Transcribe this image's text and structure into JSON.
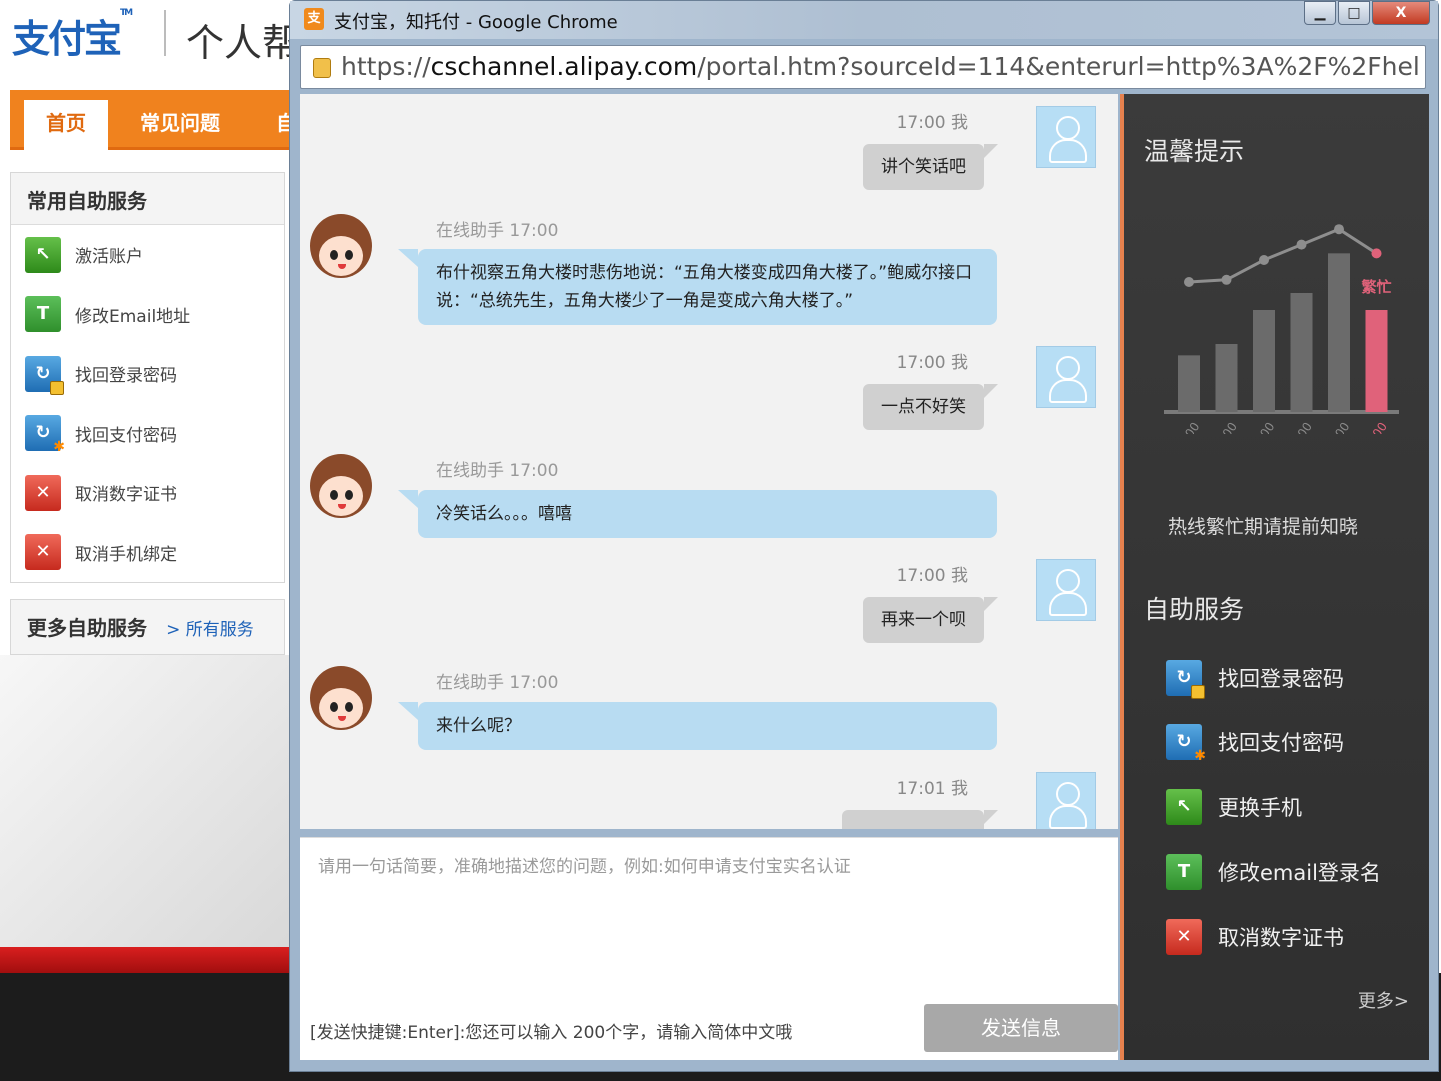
{
  "background_page": {
    "logo": "支付宝",
    "logo_tm": "TM",
    "portal_title": "个人帮",
    "tabs": [
      "首页",
      "常见问题",
      "自"
    ],
    "common_services": {
      "title": "常用自助服务",
      "items": [
        {
          "label": "激活账户",
          "icon": "activate-account-icon"
        },
        {
          "label": "修改Email地址",
          "icon": "edit-email-icon"
        },
        {
          "label": "找回登录密码",
          "icon": "recover-login-password-icon"
        },
        {
          "label": "找回支付密码",
          "icon": "recover-payment-password-icon"
        },
        {
          "label": "取消数字证书",
          "icon": "cancel-certificate-icon"
        },
        {
          "label": "取消手机绑定",
          "icon": "cancel-phone-binding-icon"
        }
      ]
    },
    "more_services": {
      "title": "更多自助服务",
      "link": "> 所有服务"
    }
  },
  "window": {
    "title": "支付宝，知托付 - Google Chrome",
    "title_icon_glyph": "支",
    "controls": {
      "minimize": "▁",
      "maximize": "□",
      "close": "X"
    },
    "url_prefix": "https://",
    "url_host": "cschannel.alipay.com",
    "url_path": "/portal.htm?sourceId=114&enterurl=http%3A%2F%2Fhelp.alipay.c"
  },
  "chat": {
    "messages": [
      {
        "from": "me",
        "meta": "17:00 我",
        "text": "讲个笑话吧"
      },
      {
        "from": "bot",
        "meta": "在线助手 17:00",
        "text": "布什视察五角大楼时悲伤地说：“五角大楼变成四角大楼了。”鲍威尔接口说：“总统先生，五角大楼少了一角是变成六角大楼了。”"
      },
      {
        "from": "me",
        "meta": "17:00 我",
        "text": "一点不好笑"
      },
      {
        "from": "bot",
        "meta": "在线助手 17:00",
        "text": "冷笑话么。。。嘻嘻"
      },
      {
        "from": "me",
        "meta": "17:00 我",
        "text": "再来一个呗"
      },
      {
        "from": "bot",
        "meta": "在线助手 17:00",
        "text": "来什么呢？"
      },
      {
        "from": "me",
        "meta": "17:01 我",
        "text": ""
      }
    ],
    "input_placeholder": "请用一句话简要，准确地描述您的问题，例如:如何申请支付宝实名认证",
    "hint": "[发送快捷键:Enter]:您还可以输入 200个字，请输入简体中文哦",
    "send_label": "发送信息"
  },
  "sidebar": {
    "tip_title": "温馨提示",
    "busy_label": "繁忙",
    "busy_footer": "热线繁忙期请提前知晓",
    "self_service_title": "自助服务",
    "items": [
      {
        "label": "找回登录密码",
        "icon": "recover-login-password-icon"
      },
      {
        "label": "找回支付密码",
        "icon": "recover-payment-password-icon"
      },
      {
        "label": "更换手机",
        "icon": "change-phone-icon"
      },
      {
        "label": "修改email登录名",
        "icon": "edit-email-icon"
      },
      {
        "label": "取消数字证书",
        "icon": "cancel-certificate-icon"
      }
    ],
    "more_label": "更多>"
  },
  "chart_data": {
    "type": "bar",
    "categories": [
      "12:00-13:00",
      "13:00-14:00",
      "14:00-15:00",
      "15:00-16:00",
      "16:00-17:00",
      "17:00-18:00"
    ],
    "values": [
      2,
      2.4,
      3.6,
      4.2,
      5.6,
      3.6
    ],
    "highlight_index": 5,
    "highlight_label": "繁忙",
    "line_values": [
      1,
      1.1,
      2,
      2.7,
      3.4,
      2.3
    ],
    "colors": {
      "bar": "#6b6b6b",
      "highlight": "#e0627a",
      "line": "#8e8e8e"
    },
    "title": "",
    "xlabel": "",
    "ylabel": ""
  }
}
